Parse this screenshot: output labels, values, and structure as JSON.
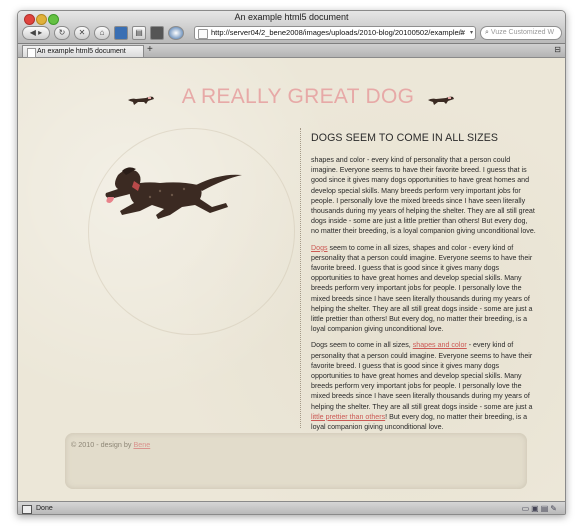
{
  "window": {
    "title": "An example html5 document"
  },
  "toolbar": {
    "back_icon": "back-arrow-icon",
    "forward_icon": "forward-arrow-icon",
    "reload_icon": "reload-icon",
    "stop_icon": "stop-icon",
    "home_icon": "home-icon",
    "url": "http://server04/2_bene2008/images/uploads/2010-blog/20100502/example/#",
    "search_placeholder": "Vuze Customized W"
  },
  "tabs": [
    {
      "label": "An example html5 document"
    }
  ],
  "page": {
    "site_title": "A REALLY GREAT DOG",
    "heading": "DOGS SEEM TO COME IN ALL SIZES",
    "paragraph1": "shapes and color - every kind of personality that a person could imagine. Everyone seems to have their favorite breed. I guess that is good since it gives many dogs opportunities to have great homes and develop special skills. Many breeds perform very important jobs for people. I personally love the mixed breeds since I have seen literally thousands during my years of helping the shelter. They are all still great dogs inside - some are just a little prettier than others! But every dog, no matter their breeding, is a loyal companion giving unconditional love.",
    "paragraph2_link": "Dogs",
    "paragraph2_rest": " seem to come in all sizes, shapes and color - every kind of personality that a person could imagine. Everyone seems to have their favorite breed. I guess that is good since it gives many dogs opportunities to have great homes and develop special skills. Many breeds perform very important jobs for people. I personally love the mixed breeds since I have seen literally thousands during my years of helping the shelter. They are all still great dogs inside - some are just a little prettier than others! But every dog, no matter their breeding, is a loyal companion giving unconditional love.",
    "paragraph3_start": "Dogs seem to come in all sizes, ",
    "paragraph3_link1": "shapes and color",
    "paragraph3_mid": " - every kind of personality that a person could imagine. Everyone seems to have their favorite breed. I guess that is good since it gives many dogs opportunities to have great homes and develop special skills. Many breeds perform very important jobs for people. I personally love the mixed breeds since I have seen literally thousands during my years of helping the shelter. They are all still great dogs inside - some are just a ",
    "paragraph3_link2": "little prettier than others",
    "paragraph3_end": "! But every dog, no matter their breeding, is a loyal companion giving unconditional love.",
    "footer_prefix": "© 2010 - design by ",
    "footer_link": "Bene"
  },
  "status": {
    "text": "Done"
  },
  "colors": {
    "title_pink": "#e7a9a7",
    "link_red": "#cc5a55",
    "page_bg": "#ece7d8"
  }
}
